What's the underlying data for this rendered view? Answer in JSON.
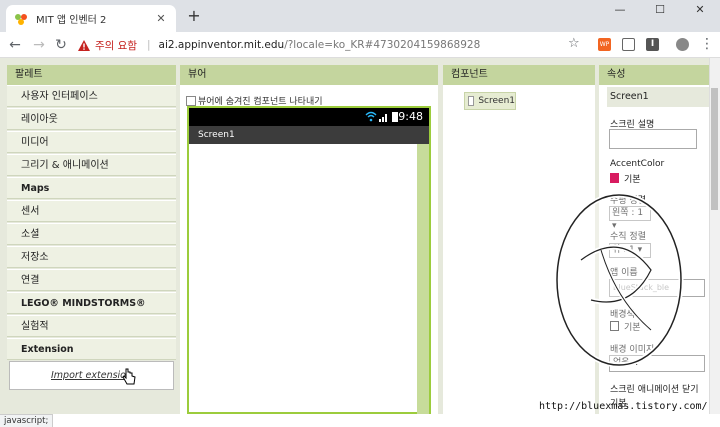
{
  "browser": {
    "tab_title": "MIT 앱 인벤터 2",
    "tab_close": "✕",
    "new_tab": "+",
    "window_controls": [
      "—",
      "☐",
      "✕"
    ],
    "security_warning": "주의 요함",
    "url_host": "ai2.appinventor.mit.edu",
    "url_rest": "/?locale=ko_KR#4730204159868928",
    "extension_labels": [
      "WP",
      "I"
    ],
    "status_link": "javascript;"
  },
  "palette": {
    "header": "팔레트",
    "items": [
      {
        "label": "사용자 인터페이스",
        "bold": false
      },
      {
        "label": "레이아웃",
        "bold": false
      },
      {
        "label": "미디어",
        "bold": false
      },
      {
        "label": "그리기 & 애니메이션",
        "bold": false
      },
      {
        "label": "Maps",
        "bold": true
      },
      {
        "label": "센서",
        "bold": false
      },
      {
        "label": "소셜",
        "bold": false
      },
      {
        "label": "저장소",
        "bold": false
      },
      {
        "label": "연결",
        "bold": false
      },
      {
        "label": "LEGO® MINDSTORMS®",
        "bold": true
      },
      {
        "label": "실험적",
        "bold": false
      },
      {
        "label": "Extension",
        "bold": true
      }
    ],
    "import_extension": "Import extension"
  },
  "viewer": {
    "header": "뷰어",
    "hidden_components_label": "뷰어에 숨겨진 컴포넌트 나타내기",
    "status_time": "9:48",
    "screen_title": "Screen1"
  },
  "components": {
    "header": "컴포넌트",
    "root": "Screen1"
  },
  "properties": {
    "header": "속성",
    "component": "Screen1",
    "screen_description_label": "스크린 설명",
    "accent_color_label": "AccentColor",
    "accent_color_value": "기본",
    "accent_color": "#d81b60",
    "align_horizontal_label": "수평 정렬",
    "align_horizontal_value": "왼쪽 : 1 ▾",
    "align_vertical_label": "수직 정렬",
    "align_vertical_value": "위 : 1 ▾",
    "app_name_label": "앱 이름",
    "app_name_value": "BlueStack_ble",
    "background_color_label": "배경색",
    "background_color_value": "기본",
    "background_image_label": "배경 이미지",
    "background_image_value": "없음...",
    "close_animation_label": "스크린 애니메이션 닫기",
    "close_animation_value": "기본"
  },
  "watermark": {
    "url": "http://bluexmas.tistory.com/"
  },
  "colors": {
    "header_green": "#c4d59e",
    "page_bg": "#e6e9dc",
    "phone_border": "#9ccc3c",
    "warning_red": "#c5221f"
  }
}
